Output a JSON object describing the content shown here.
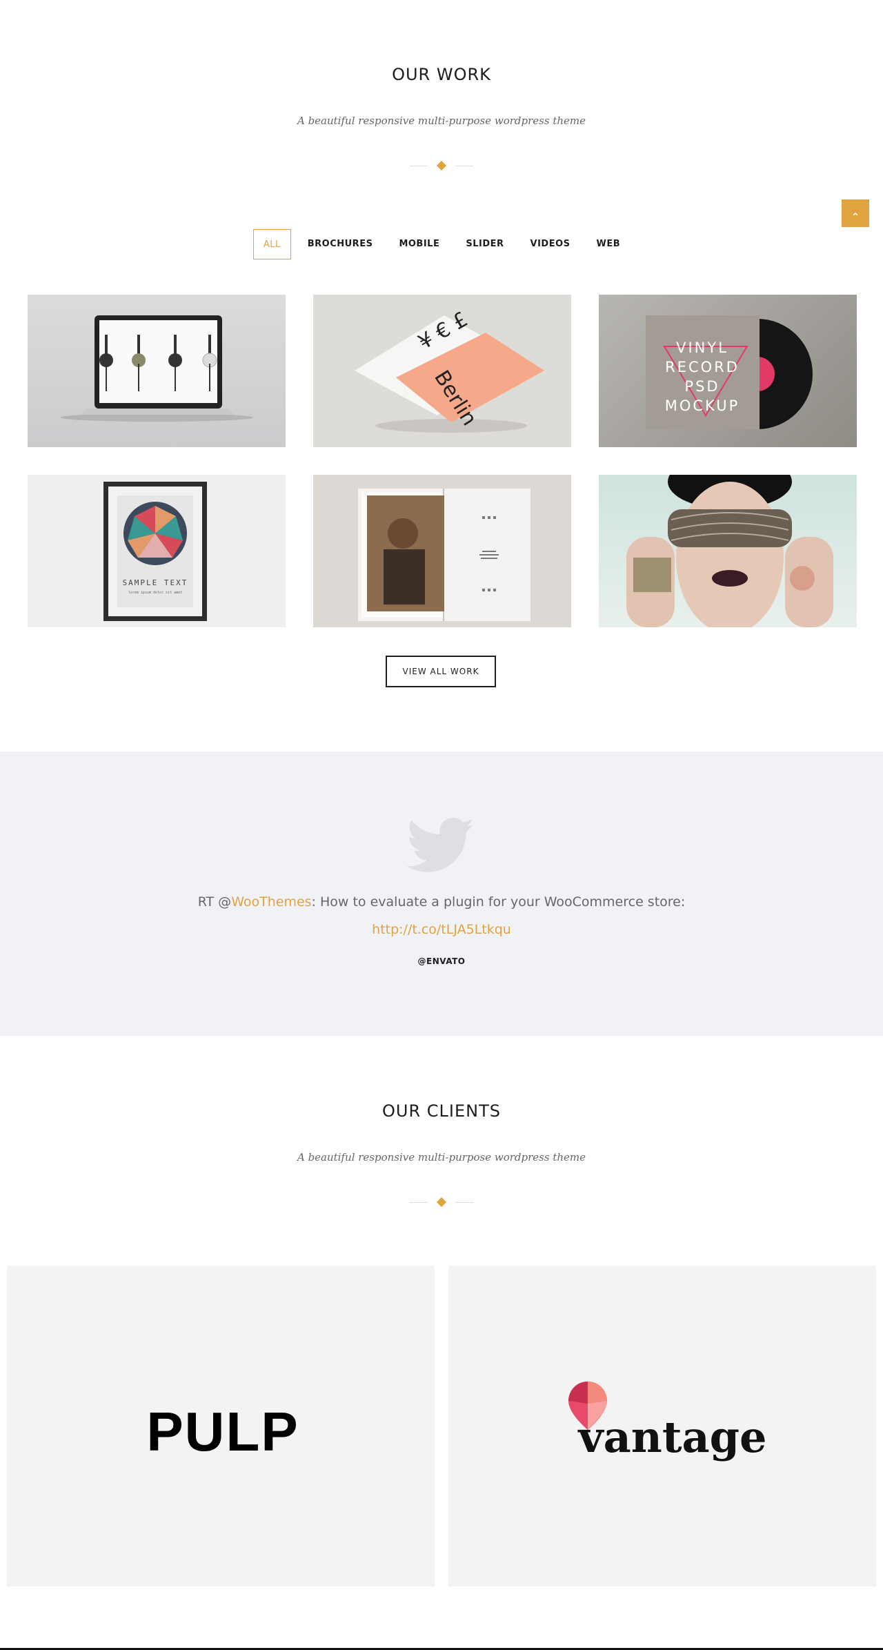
{
  "work": {
    "title": "OUR WORK",
    "subtitle": "A beautiful responsive multi-purpose wordpress theme",
    "filters": [
      "ALL",
      "BROCHURES",
      "MOBILE",
      "SLIDER",
      "VIDEOS",
      "WEB"
    ],
    "active_filter": "ALL",
    "items": [
      {
        "kind": "laptop-headphones"
      },
      {
        "kind": "berlin-brochure",
        "text": "Berlin",
        "symbols": "¥ € £"
      },
      {
        "kind": "vinyl-mockup",
        "lines": [
          "VINYL",
          "RECORD",
          "PSD",
          "MOCKUP"
        ]
      },
      {
        "kind": "poster-frame",
        "text": "SAMPLE TEXT",
        "subtext": "lorem ipsum dolor sit amet"
      },
      {
        "kind": "open-magazine"
      },
      {
        "kind": "fashion-portrait"
      }
    ],
    "view_all_label": "VIEW ALL WORK",
    "back_to_top_icon": "chevron-up-icon"
  },
  "twitter": {
    "prefix": "RT @",
    "mention": "WooThemes",
    "text": ": How to evaluate a plugin for your WooCommerce store:",
    "link": "http://t.co/tLJA5Ltkqu",
    "handle": "@ENVATO"
  },
  "clients": {
    "title": "OUR CLIENTS",
    "subtitle": "A beautiful responsive multi-purpose wordpress theme",
    "logos": [
      {
        "name": "PULP"
      },
      {
        "name": "vantage"
      }
    ]
  },
  "colors": {
    "accent": "#e0a340",
    "band": "#f1f2f6",
    "dark": "#1d1d1d",
    "tile": "#f3f3f3"
  }
}
